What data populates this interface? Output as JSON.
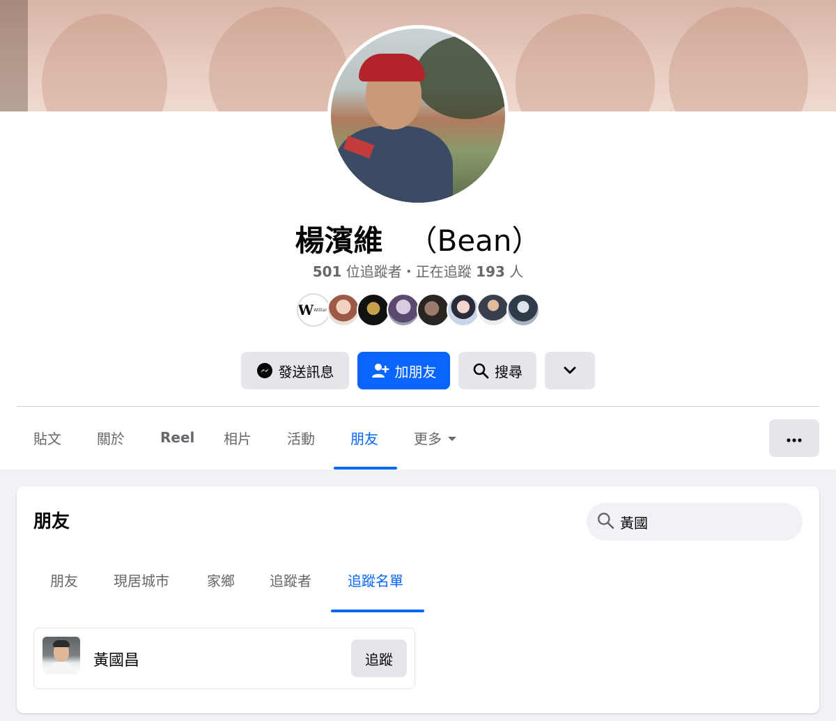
{
  "profile": {
    "name": "楊濱維",
    "alt_name": "（Bean）",
    "followers_count": "501",
    "followers_text": " 位追蹤者・正在追蹤 ",
    "following_count": "193",
    "following_suffix": " 人"
  },
  "actions": {
    "message": "發送訊息",
    "add_friend": "加朋友",
    "search": "搜尋"
  },
  "profile_tabs": [
    "貼文",
    "關於",
    "Reel",
    "相片",
    "活動",
    "朋友",
    "更多"
  ],
  "friends_section": {
    "title": "朋友",
    "search_value": "黃國",
    "tabs": [
      "朋友",
      "現居城市",
      "家鄉",
      "追蹤者",
      "追蹤名單"
    ],
    "results": [
      {
        "name": "黃國昌",
        "button": "追蹤"
      }
    ]
  },
  "mutual_avatar_label": "William",
  "colors": {
    "accent": "#0866ff",
    "button_grey": "#e4e6eb",
    "text_secondary": "#65676b",
    "background_grey": "#f0f2f5"
  }
}
